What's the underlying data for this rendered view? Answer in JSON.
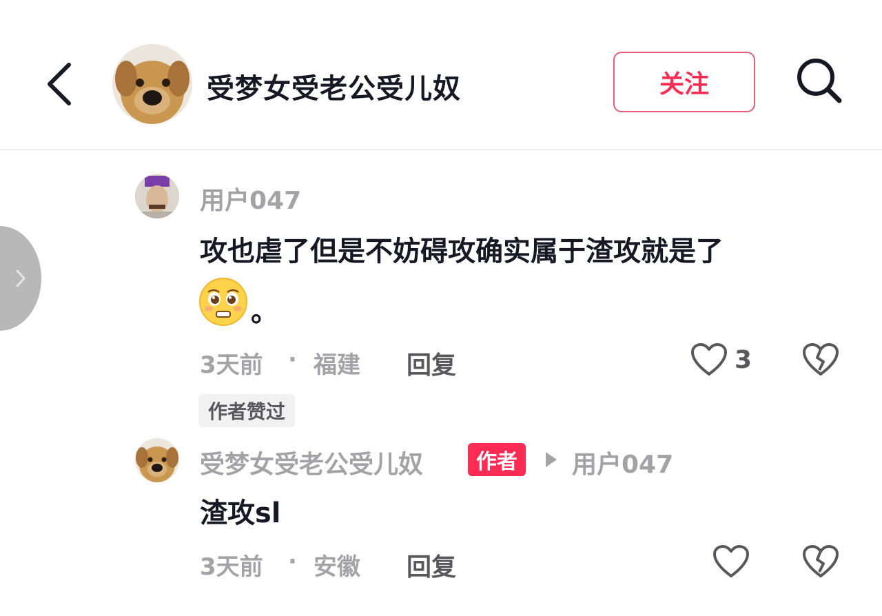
{
  "header": {
    "title": "受梦女受老公受儿奴",
    "follow_label": "关注",
    "back_icon": "chevron-left-icon",
    "search_icon": "search-icon"
  },
  "comments": [
    {
      "username": "用户047",
      "text_line1": "攻也虐了但是不妨碍攻确实属于渣攻就是了",
      "text_line2_suffix": "。",
      "emoji": "pleading-face-emoji",
      "time": "3天前",
      "separator": "·",
      "location": "福建",
      "reply_label": "回复",
      "like_count": "3",
      "author_liked_label": "作者赞过"
    },
    {
      "username": "受梦女受老公受儿奴",
      "author_badge": "作者",
      "reply_to": "用户047",
      "text": "渣攻sl",
      "time": "3天前",
      "separator": "·",
      "location": "安徽",
      "reply_label": "回复"
    }
  ],
  "colors": {
    "accent": "#fe2c55",
    "muted_text": "#a3a3a7",
    "primary_text": "#161823"
  }
}
